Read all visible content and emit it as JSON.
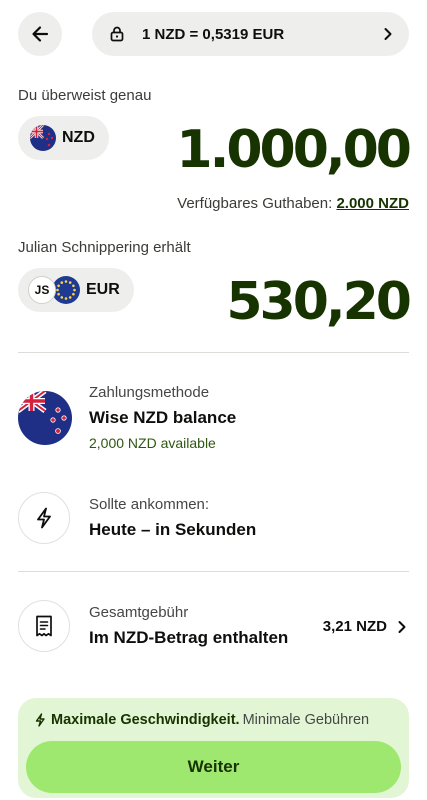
{
  "header": {
    "back_icon": "arrow-left-icon",
    "rate_icon": "lock-icon",
    "rate_text": "1 NZD = 0,5319 EUR",
    "rate_chevron": "chevron-right-icon"
  },
  "send": {
    "label": "Du überweist genau",
    "currency": "NZD",
    "amount": "1.000,00",
    "balance_label": "Verfügbares Guthaben:",
    "balance_value": "2.000 NZD"
  },
  "receive": {
    "label": "Julian Schnippering erhält",
    "initials": "JS",
    "currency": "EUR",
    "amount": "530,20"
  },
  "payment": {
    "sub": "Zahlungsmethode",
    "main": "Wise NZD balance",
    "extra": "2,000 NZD available"
  },
  "arrival": {
    "icon": "lightning-icon",
    "sub": "Sollte ankommen:",
    "main": "Heute – in Sekunden"
  },
  "fee": {
    "icon": "receipt-icon",
    "sub": "Gesamtgebühr",
    "main": "Im NZD-Betrag enthalten",
    "amount": "3,21 NZD"
  },
  "footer": {
    "speed_bold": "Maximale Geschwindigkeit.",
    "speed_rest": "Minimale Gebühren",
    "cta": "Weiter"
  },
  "colors": {
    "brand_dark": "#163300",
    "brand_green": "#9fe870",
    "card_bg": "#e2f6d5",
    "pill_bg": "#eeefec"
  }
}
